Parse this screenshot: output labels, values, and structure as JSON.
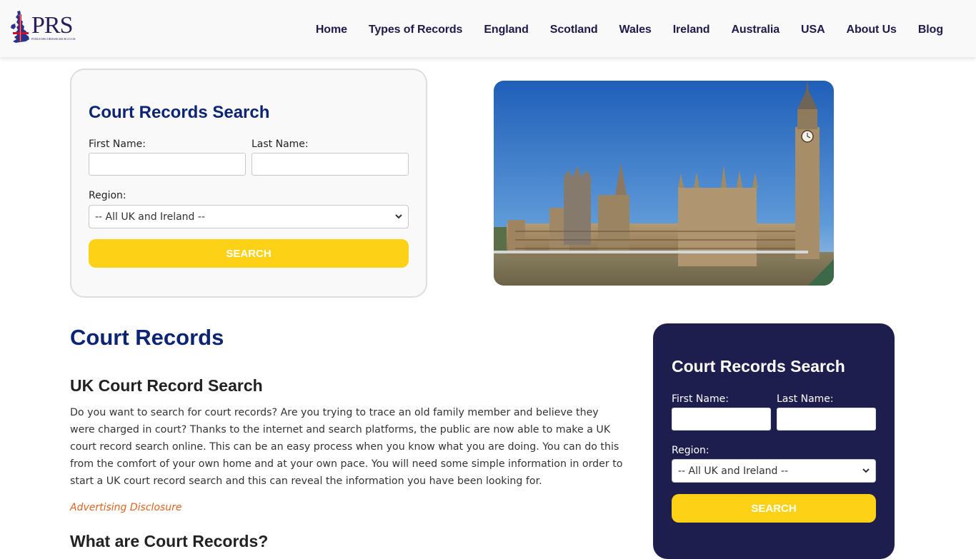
{
  "header": {
    "logo_text": "PRS",
    "logo_subtext": "PUBLICRECORDSSEARCH.CO.UK",
    "nav": [
      {
        "label": "Home"
      },
      {
        "label": "Types of Records"
      },
      {
        "label": "England"
      },
      {
        "label": "Scotland"
      },
      {
        "label": "Wales"
      },
      {
        "label": "Ireland"
      },
      {
        "label": "Australia"
      },
      {
        "label": "USA"
      },
      {
        "label": "About Us"
      },
      {
        "label": "Blog"
      }
    ]
  },
  "top_search": {
    "title": "Court Records Search",
    "first_name_label": "First Name:",
    "first_name_value": "",
    "last_name_label": "Last Name:",
    "last_name_value": "",
    "region_label": "Region:",
    "region_selected": "-- All UK and Ireland --",
    "button_label": "SEARCH"
  },
  "hero_image": {
    "alt": "Houses of Parliament and Big Ben, London"
  },
  "main": {
    "title": "Court Records",
    "section1_heading": "UK Court Record Search",
    "section1_text": "Do you want to search for court records? Are you trying to trace an old family member and believe they were charged in court? Thanks to the internet and search platforms, the public are now able to make a UK court record search online. This can be an easy process when you know what you are doing. You can do this from the comfort of your own home and at your own pace. You will need some simple information in order to start a UK court record search and this can reveal the information you have been looking for.",
    "advertising_link": "Advertising Disclosure",
    "section2_heading": "What are Court Records?"
  },
  "sidebar_search": {
    "title": "Court Records Search",
    "first_name_label": "First Name:",
    "first_name_value": "",
    "last_name_label": "Last Name:",
    "last_name_value": "",
    "region_label": "Region:",
    "region_selected": "-- All UK and Ireland --",
    "button_label": "SEARCH"
  },
  "colors": {
    "brand_navy": "#0c2474",
    "sidebar_bg": "#1e1e4e",
    "button_yellow": "#fcd116",
    "link_orange": "#e0621e",
    "nav_text": "#1e1a4a"
  }
}
